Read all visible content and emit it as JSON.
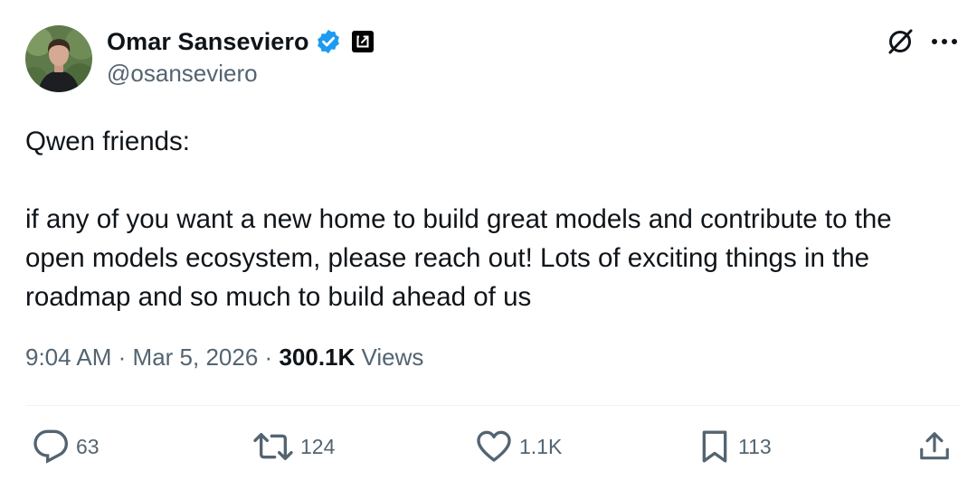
{
  "author": {
    "display_name": "Omar Sanseviero",
    "handle": "@osanseviero",
    "verified": true
  },
  "tweet": {
    "lines": [
      "Qwen friends:",
      "if any of you want a new home to build great models and contribute to the open models ecosystem, please reach out! Lots of exciting things in the roadmap and so much to build ahead of us"
    ]
  },
  "meta": {
    "time": "9:04 AM",
    "sep1": "·",
    "date": "Mar 5, 2026",
    "sep2": "·",
    "views_count": "300.1K",
    "views_label": "Views"
  },
  "actions": {
    "replies": "63",
    "reposts": "124",
    "likes": "1.1K",
    "bookmarks": "113"
  },
  "icons": {
    "reply": "reply-icon",
    "repost": "repost-icon",
    "like": "heart-icon",
    "bookmark": "bookmark-icon",
    "share": "share-icon",
    "grok": "grok-icon",
    "more": "more-icon",
    "verified": "verified-badge-icon",
    "affiliate": "affiliate-icon"
  },
  "colors": {
    "text": "#0f1419",
    "secondary": "#536471",
    "verified": "#1d9bf0"
  }
}
